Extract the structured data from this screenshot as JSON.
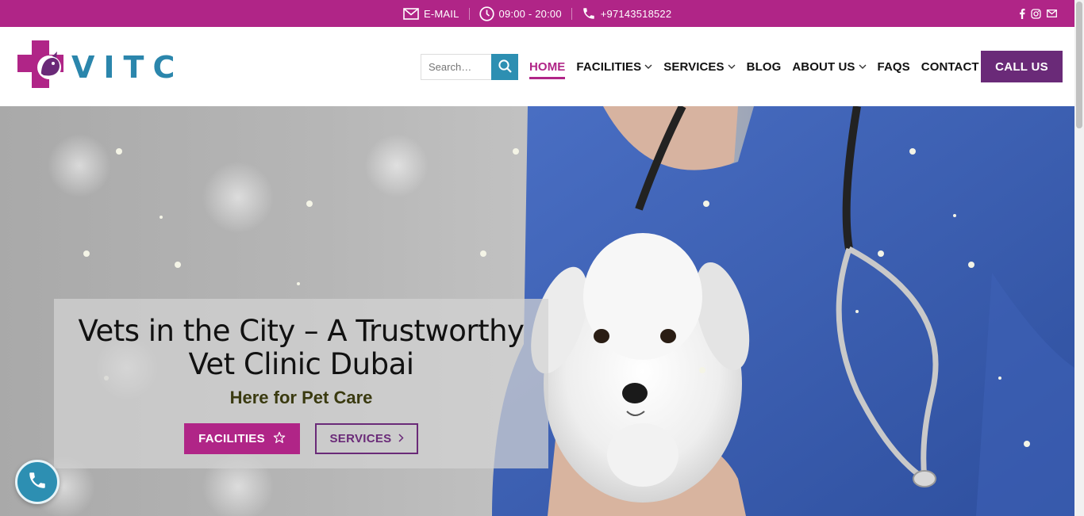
{
  "topbar": {
    "email_label": "E-MAIL",
    "hours": "09:00 - 20:00",
    "phone": "+97143518522",
    "bg_color": "#b02587"
  },
  "logo": {
    "text": "VITC"
  },
  "search": {
    "placeholder": "Search…"
  },
  "nav": {
    "items": [
      {
        "label": "HOME",
        "active": true,
        "dropdown": false
      },
      {
        "label": "FACILITIES",
        "active": false,
        "dropdown": true
      },
      {
        "label": "SERVICES",
        "active": false,
        "dropdown": true
      },
      {
        "label": "BLOG",
        "active": false,
        "dropdown": false
      },
      {
        "label": "ABOUT US",
        "active": false,
        "dropdown": true
      },
      {
        "label": "FAQS",
        "active": false,
        "dropdown": false
      },
      {
        "label": "CONTACT US",
        "active": false,
        "dropdown": false
      }
    ],
    "cta_label": "CALL US",
    "accent_color": "#b02587",
    "cta_color": "#6a2a78"
  },
  "hero": {
    "title": "Vets in the City – A Trustworthy Vet Clinic Dubai",
    "subtitle": "Here for Pet Care",
    "primary_button": "FACILITIES",
    "secondary_button": "SERVICES"
  },
  "icons": {
    "email": "envelope-icon",
    "hours": "clock-icon",
    "phone": "phone-icon",
    "social": [
      "facebook-icon",
      "instagram-icon",
      "envelope-icon"
    ],
    "search": "search-icon",
    "facilities_button": "star-icon",
    "services_button": "chevron-right-icon",
    "floating": "phone-icon"
  }
}
